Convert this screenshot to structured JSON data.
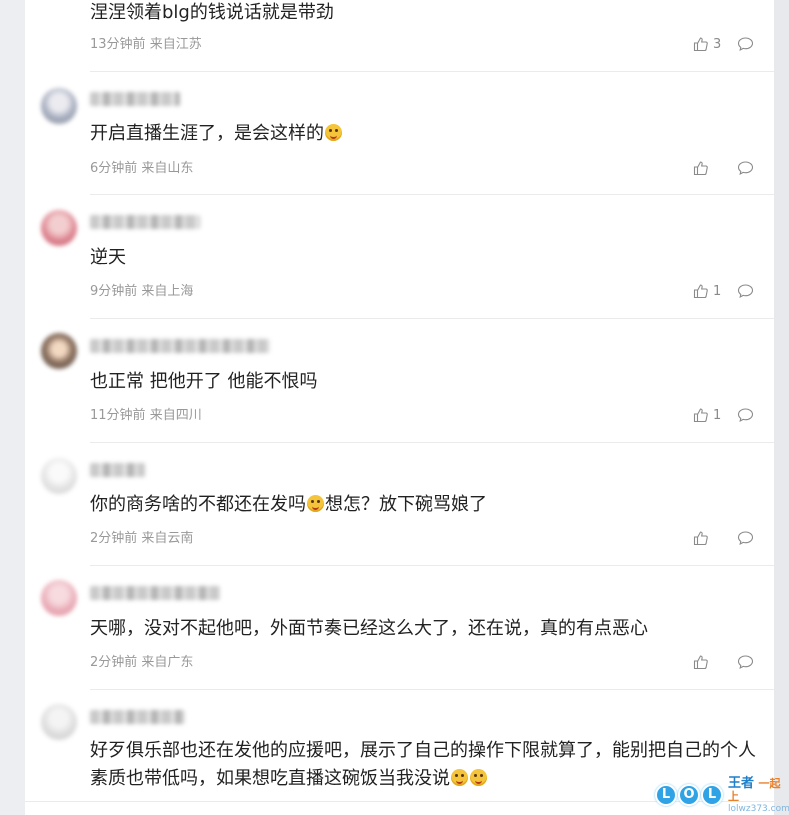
{
  "comments": [
    {
      "content": "涅涅领着blg的钱说话就是带劲",
      "time": "13分钟前",
      "location": "来自江苏",
      "likes": "3"
    },
    {
      "content": "开启直播生涯了，是会这样的",
      "time": "6分钟前",
      "location": "来自山东",
      "likes": ""
    },
    {
      "content": "逆天",
      "time": "9分钟前",
      "location": "来自上海",
      "likes": "1"
    },
    {
      "content": "也正常 把他开了 他能不恨吗",
      "time": "11分钟前",
      "location": "来自四川",
      "likes": "1"
    },
    {
      "content_a": "你的商务啥的不都还在发吗",
      "content_b": "想怎？放下碗骂娘了",
      "time": "2分钟前",
      "location": "来自云南",
      "likes": ""
    },
    {
      "content": "天哪，没对不起他吧，外面节奏已经这么大了，还在说，真的有点恶心",
      "time": "2分钟前",
      "location": "来自广东",
      "likes": ""
    },
    {
      "content": "好歹俱乐部也还在发他的应援吧，展示了自己的操作下限就算了，能别把自己的个人素质也带低吗，如果想吃直播这碗饭当我没说",
      "time": "",
      "location": "",
      "likes": ""
    }
  ],
  "icons": {
    "like": "thumbs-up-icon",
    "reply": "comment-bubble-icon",
    "emoji": "smile-face-emoji"
  },
  "watermark": {
    "logo_letters": [
      "L",
      "O",
      "L"
    ],
    "title": "王者",
    "title_accent": "一起上",
    "url": "lolwz373.com"
  },
  "colors": {
    "meta_text": "#999999",
    "content_text": "#222222",
    "divider": "#ebebeb",
    "watermark_blue": "#2fa3e6"
  }
}
